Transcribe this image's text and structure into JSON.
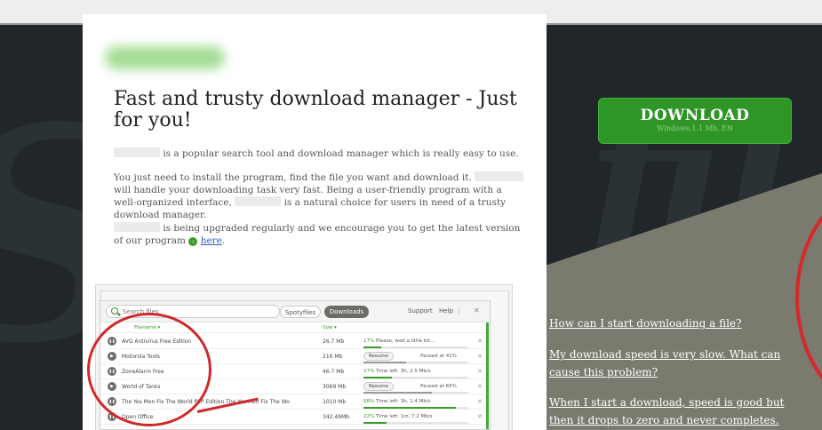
{
  "hero": {
    "headline": "Fast and trusty download manager - Just for you!",
    "p1_text": "is a popular search tool and download manager which is really easy to use.",
    "p2_a": "You just need to install the program, find the file you want and download it.",
    "p2_b": "will handle your downloading task very fast. Being a user-friendly program with a well-organized interface,",
    "p2_c": "is a natural choice for users in need of a trusty download manager.",
    "p3_a": "is being upgraded regularly and we encourage you to get the latest version of our program",
    "p3_link": "here",
    "p3_end": "."
  },
  "download_button": {
    "label": "DOWNLOAD",
    "sublabel": "Windows,1.1 Mb, EN"
  },
  "faq": [
    "How can I start downloading a file?",
    "My download speed is very slow. What can cause this problem?",
    "When I start a download, speed is good but then it drops to zero and never completes. What is"
  ],
  "app": {
    "search_placeholder": "Search files",
    "tabs": [
      "Spotyfiles",
      "Downloads"
    ],
    "active_tab": "Downloads",
    "links": {
      "support": "Support",
      "help": "Help"
    },
    "columns": {
      "name": "Filename ▾",
      "size": "Size ▾"
    },
    "rows": [
      {
        "name": "AVG Antivirus Free Edition",
        "size": "26.7 Mb",
        "status": "Please, wait a little bit...",
        "percent": "17%",
        "progress": 0.17,
        "paused": false
      },
      {
        "name": "Motorola Tools",
        "size": "216 Mb",
        "resume": "Resume",
        "status": "Paused at 41%",
        "progress": 0.41,
        "paused": true
      },
      {
        "name": "ZoneAlarm Free",
        "size": "46.7 Mb",
        "status": "Time left: 3h, 2.5 Mb/s",
        "percent": "27%",
        "progress": 0.27,
        "paused": false
      },
      {
        "name": "World of Tanks",
        "size": "3069 Mb",
        "resume": "Resume",
        "status": "Paused at 65%",
        "progress": 0.65,
        "paused": true
      },
      {
        "name": "The Yes Men Fix The World P2P Edition The Yes Men Fix The Wo",
        "size": "1010 Mb",
        "status": "Time left: 3h, 1.4 Mb/s",
        "percent": "88%",
        "progress": 0.88,
        "paused": false
      },
      {
        "name": "Open Office",
        "size": "342.49Mb",
        "status": "Time left: 1m, 7.2 Mb/s",
        "percent": "22%",
        "progress": 0.22,
        "paused": false
      }
    ]
  },
  "colors": {
    "accent_green": "#2f9527",
    "dark_background": "#202629",
    "gray_panel": "#7a7a6f",
    "highlight_red": "#d0292b"
  }
}
